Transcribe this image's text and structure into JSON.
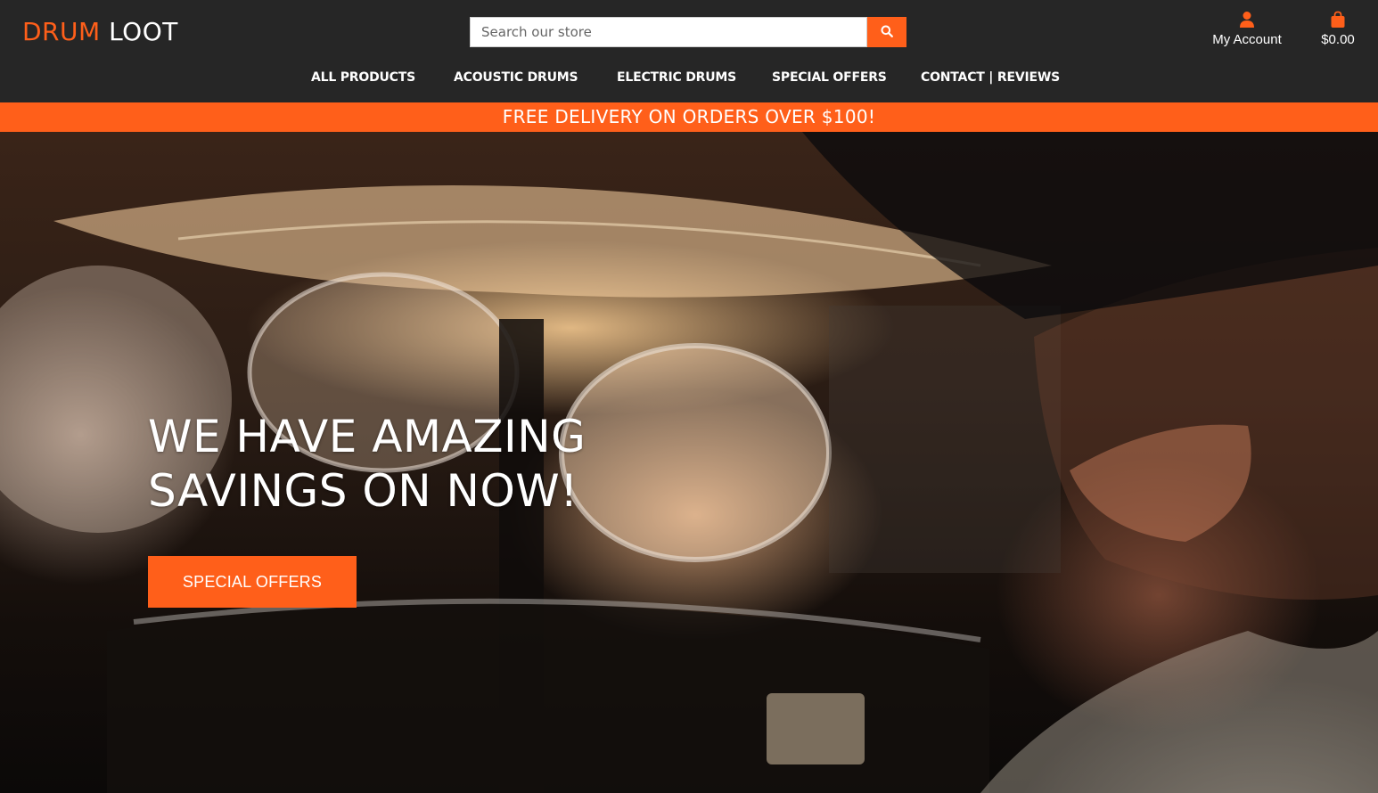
{
  "brand": {
    "part1": "DRUM",
    "part2": "LOOT"
  },
  "search": {
    "placeholder": "Search our store",
    "value": "",
    "button_icon": "search-icon"
  },
  "account": {
    "label": "My Account",
    "icon": "user-icon"
  },
  "cart": {
    "total": "$0.00",
    "icon": "shopping-bag-icon"
  },
  "nav": {
    "items": [
      {
        "label": "ALL PRODUCTS"
      },
      {
        "label": "ACOUSTIC DRUMS"
      },
      {
        "label": "ELECTRIC DRUMS"
      },
      {
        "label": "SPECIAL OFFERS"
      },
      {
        "label": "CONTACT | REVIEWS"
      }
    ]
  },
  "banner": {
    "text": "FREE DELIVERY ON ORDERS OVER $100!"
  },
  "hero": {
    "title_line1": "WE HAVE AMAZING",
    "title_line2": "SAVINGS ON NOW!",
    "button_label": "SPECIAL OFFERS",
    "image_description": "drum-kit-photo"
  },
  "colors": {
    "accent": "#ff5f1a",
    "header_bg": "#262626"
  }
}
